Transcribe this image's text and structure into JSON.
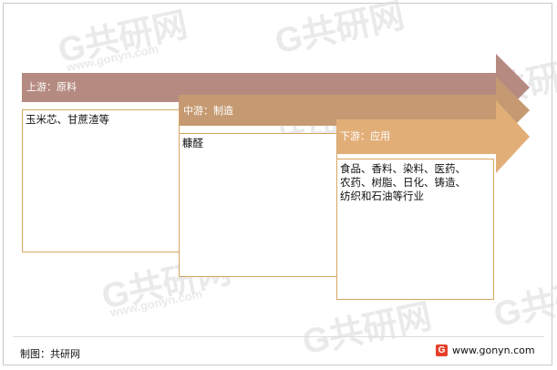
{
  "watermark": {
    "logo_text": "G共研网",
    "site_text": "www.gonyn.com"
  },
  "stages": [
    {
      "title": "上游：原料",
      "lines": [
        "玉米芯、甘蔗渣等"
      ],
      "color": "#b58a80"
    },
    {
      "title": "中游：制造",
      "lines": [
        "糠醛"
      ],
      "color": "#c59a72"
    },
    {
      "title": "下游：应用",
      "lines": [
        "食品、香料、染料、医药、",
        "农药、树脂、日化、铸造、",
        "纺织和石油等行业"
      ],
      "color": "#e2ae78"
    }
  ],
  "footer": {
    "source": "制图：共研网",
    "website": "www.gonyn.com",
    "logo_glyph": "G"
  }
}
